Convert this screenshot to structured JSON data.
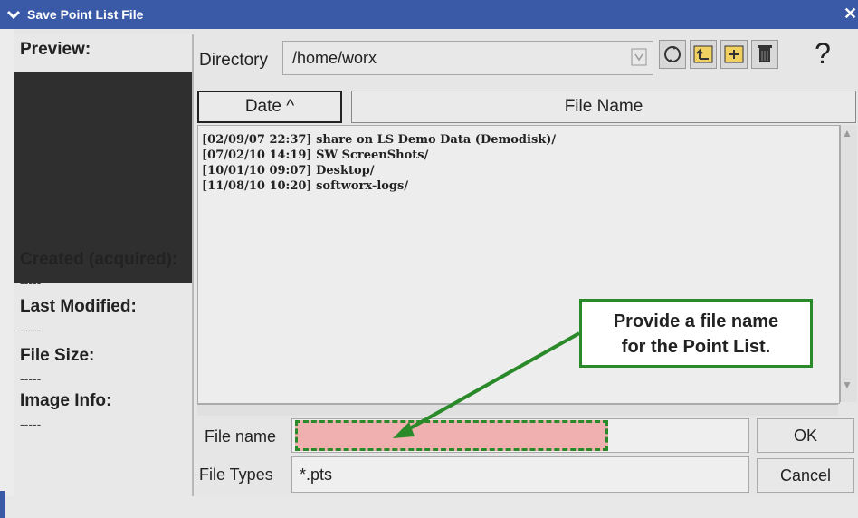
{
  "window": {
    "title": "Save Point List File"
  },
  "left_panel": {
    "preview_label": "Preview:",
    "created_label": "Created (acquired):",
    "created_value": "-----",
    "modified_label": "Last Modified:",
    "modified_value": "-----",
    "size_label": "File Size:",
    "size_value": "-----",
    "image_info_label": "Image Info:",
    "image_info_value": "-----"
  },
  "directory": {
    "label": "Directory",
    "value": "/home/worx"
  },
  "toolbar": {
    "icons": [
      "refresh-icon",
      "parent-directory-icon",
      "new-folder-icon",
      "trash-icon",
      "help-icon"
    ],
    "help_glyph": "?"
  },
  "file_list": {
    "columns": [
      "Date ^",
      "File Name"
    ],
    "rows": [
      "[02/09/07 22:37] share on LS Demo Data (Demodisk)/",
      "[07/02/10 14:19] SW ScreenShots/",
      "[10/01/10 09:07] Desktop/",
      "[11/08/10 10:20] softworx-logs/"
    ]
  },
  "file_name": {
    "label": "File name",
    "value": ""
  },
  "file_types": {
    "label": "File Types",
    "value": "*.pts"
  },
  "buttons": {
    "ok": "OK",
    "cancel": "Cancel"
  },
  "callout": {
    "line1": "Provide a file name",
    "line2": "for the Point List."
  },
  "colors": {
    "title_bar": "#3a5aa8",
    "callout_border": "#2a8a2a",
    "highlight_fill": "#f0b0b0"
  }
}
